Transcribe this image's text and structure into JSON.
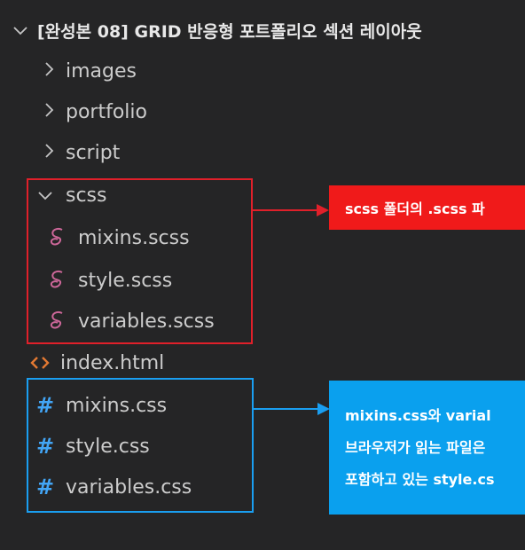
{
  "explorer": {
    "root_label": "[완성본 08] GRID 반응형 포트폴리오 섹션 레이아웃",
    "folders": [
      {
        "label": "images"
      },
      {
        "label": "portfolio"
      },
      {
        "label": "script"
      },
      {
        "label": "scss"
      }
    ],
    "scss_files": [
      {
        "label": "mixins.scss"
      },
      {
        "label": "style.scss"
      },
      {
        "label": "variables.scss"
      }
    ],
    "html_file": {
      "label": "index.html"
    },
    "css_files": [
      {
        "label": "mixins.css"
      },
      {
        "label": "style.css"
      },
      {
        "label": "variables.css"
      }
    ]
  },
  "icons": {
    "chevron_right": "›",
    "chevron_down": "⌄",
    "sass": "S",
    "css": "#",
    "html": "<>"
  },
  "annotations": {
    "scss_note": "scss 폴더의 .scss 파",
    "css_note_lines": [
      "mixins.css와 varial",
      "브라우저가 읽는 파일은",
      "포함하고 있는 style.cs"
    ]
  },
  "colors": {
    "background": "#252526",
    "red_highlight": "#e0202a",
    "blue_highlight": "#1a9ef0",
    "sass_icon": "#cd6799",
    "css_icon": "#42a5f5",
    "html_icon": "#e37933"
  }
}
